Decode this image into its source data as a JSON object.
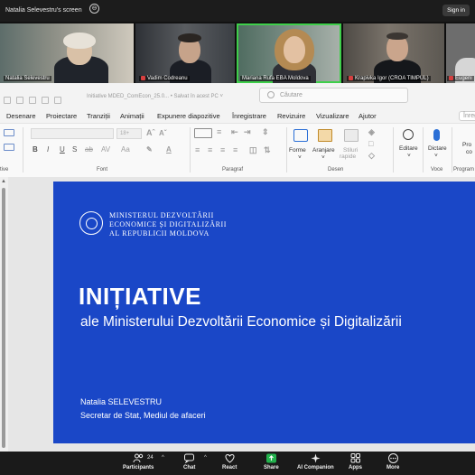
{
  "zoom": {
    "screen_title": "Natalia Selevestru's screen",
    "sign_in": "Sign in",
    "minimize_symbol": "⊖",
    "participants": [
      {
        "name": "Natalia Selevestru",
        "muted": false
      },
      {
        "name": "Vadim Codreanu",
        "muted": true
      },
      {
        "name": "Mariana Rufa EBA Moldova",
        "muted": false,
        "active_speaker": true
      },
      {
        "name": "Krapivka Igor (CROA TIMPUL)",
        "muted": true
      },
      {
        "name": "Eugeni",
        "muted": true
      }
    ],
    "toolbar": {
      "participants_label": "Participants",
      "participants_count": "24",
      "chat_label": "Chat",
      "react_label": "React",
      "share_label": "Share",
      "ai_label": "AI Companion",
      "apps_label": "Apps",
      "more_label": "More"
    }
  },
  "ppt": {
    "doc_title": "Initiative MDED_ComEcon_25.0...  • Salvat în acest PC  ˅",
    "search_placeholder": "Căutare",
    "tabs": [
      "Desenare",
      "Proiectare",
      "Tranziții",
      "Animații",
      "Expunere diapozitive",
      "Înregistrare",
      "Revizuire",
      "Vizualizare",
      "Ajutor"
    ],
    "comments_label": "Înreg",
    "groups": {
      "font": "Font",
      "paragraph": "Paragraf",
      "drawing": "Desen",
      "voice": "Voce",
      "program": "Program",
      "partial_left": "tive"
    },
    "buttons": {
      "forme": "Forme",
      "aranjare": "Aranjare",
      "stiluri": "Stiluri",
      "stiluri2": "rapide",
      "editare": "Editare",
      "dictare": "Dictare",
      "pro": "Pro",
      "pro2": "co"
    },
    "font_size_placeholder": "18+"
  },
  "slide": {
    "ministry_line1": "MINISTERUL DEZVOLTĂRII",
    "ministry_line2": "ECONOMICE ȘI DIGITALIZĂRII",
    "ministry_line3": "AL REPUBLICII MOLDOVA",
    "title": "INIȚIATIVE",
    "subtitle": "ale Ministerului Dezvoltării Economice și Digitalizării",
    "author_name": "Natalia SELEVESTRU",
    "author_role": "Secretar de Stat, Mediul de afaceri"
  },
  "colors": {
    "slide_bg": "#1a47c7",
    "active_speaker": "#3ecf4a",
    "share_green": "#22b14c"
  }
}
